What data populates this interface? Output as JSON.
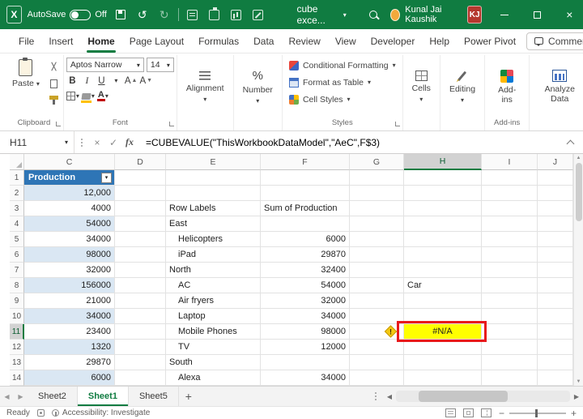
{
  "colors": {
    "titlebar": "#107C41",
    "accent": "#107C41",
    "table-header": "#2E75B6",
    "band": "#DAE7F3",
    "cell-yellow": "#FFFF00",
    "annotation-red": "#E8191C",
    "warning": "#F2C811",
    "avatar": "#B5382E"
  },
  "titlebar": {
    "autosave_label": "AutoSave",
    "autosave_state": "Off",
    "doc_title": "cube exce...",
    "user_name": "Kunal Jai Kaushik",
    "user_initials": "KJ"
  },
  "menubar": {
    "items": [
      "File",
      "Insert",
      "Home",
      "Page Layout",
      "Formulas",
      "Data",
      "Review",
      "View",
      "Developer",
      "Help",
      "Power Pivot"
    ],
    "active": "Home",
    "comments_label": "Comments"
  },
  "ribbon": {
    "paste_label": "Paste",
    "clipboard_label": "Clipboard",
    "font_name": "Aptos Narrow",
    "font_size": "14",
    "font_group_label": "Font",
    "alignment_label": "Alignment",
    "number_label": "Number",
    "styles": {
      "conditional": "Conditional Formatting",
      "format_table": "Format as Table",
      "cell_styles": "Cell Styles"
    },
    "styles_group_label": "Styles",
    "cells_label": "Cells",
    "editing_label": "Editing",
    "addins_label": "Add-ins",
    "addins_group_label": "Add-ins",
    "analyze_label": "Analyze Data"
  },
  "formula_bar": {
    "name_box": "H11",
    "fx_label": "fx",
    "formula": "=CUBEVALUE(\"ThisWorkbookDataModel\",\"AeC\",F$3)"
  },
  "grid": {
    "columns": [
      "C",
      "D",
      "E",
      "F",
      "G",
      "H",
      "I",
      "J"
    ],
    "selected_column": "H",
    "selected_row": "11",
    "rows": [
      {
        "num": "1",
        "c_header": true,
        "cells": {
          "C": "Production"
        }
      },
      {
        "num": "2",
        "cells": {
          "C": "12,000"
        }
      },
      {
        "num": "3",
        "cells": {
          "C": "4000",
          "E": "Row Labels",
          "F": "Sum of Production"
        }
      },
      {
        "num": "4",
        "cells": {
          "C": "54000",
          "E": "East"
        }
      },
      {
        "num": "5",
        "cells": {
          "C": "34000",
          "E": "Helicopters",
          "F": "6000"
        },
        "indent_e": true
      },
      {
        "num": "6",
        "cells": {
          "C": "98000",
          "E": "iPad",
          "F": "29870"
        },
        "indent_e": true
      },
      {
        "num": "7",
        "cells": {
          "C": "32000",
          "E": "North",
          "F": "32400"
        }
      },
      {
        "num": "8",
        "cells": {
          "C": "156000",
          "E": "AC",
          "F": "54000",
          "H": "Car"
        },
        "indent_e": true
      },
      {
        "num": "9",
        "cells": {
          "C": "21000",
          "E": "Air fryers",
          "F": "32000"
        },
        "indent_e": true
      },
      {
        "num": "10",
        "cells": {
          "C": "34000",
          "E": "Laptop",
          "F": "34000"
        },
        "indent_e": true
      },
      {
        "num": "11",
        "cells": {
          "C": "23400",
          "E": "Mobile Phones",
          "F": "98000",
          "H": "#N/A"
        },
        "indent_e": true,
        "h_error": true,
        "warning": true
      },
      {
        "num": "12",
        "cells": {
          "C": "1320",
          "E": "TV",
          "F": "12000"
        },
        "indent_e": true
      },
      {
        "num": "13",
        "cells": {
          "C": "29870",
          "E": "South"
        }
      },
      {
        "num": "14",
        "cells": {
          "C": "6000",
          "E": "Alexa",
          "F": "34000"
        },
        "indent_e": true
      }
    ]
  },
  "sheet_tabs": {
    "tabs": [
      "Sheet2",
      "Sheet1",
      "Sheet5"
    ],
    "active": "Sheet1"
  },
  "status_bar": {
    "ready": "Ready",
    "accessibility": "Accessibility: Investigate"
  }
}
